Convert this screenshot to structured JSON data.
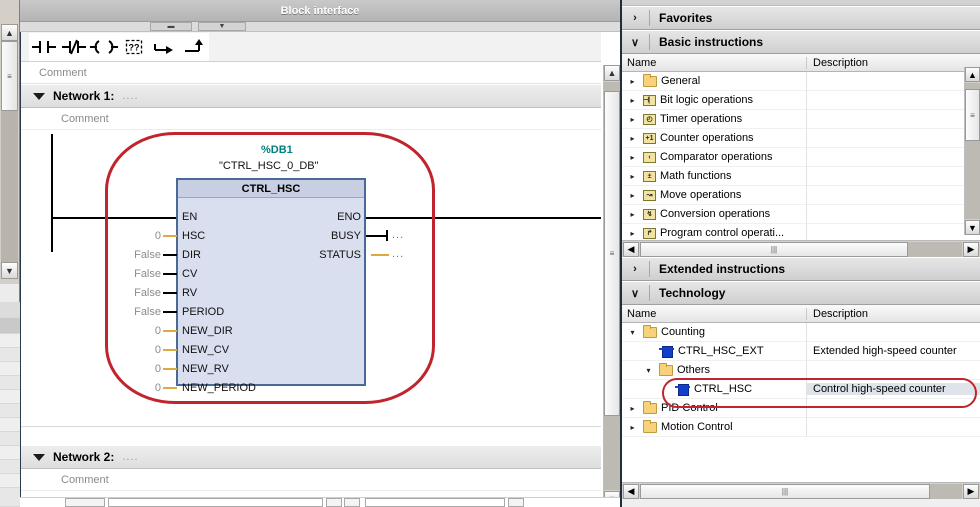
{
  "editor": {
    "block_interface_title": "Block interface",
    "toolbar": [
      {
        "name": "contact-no-icon",
        "label": "Normally open contact"
      },
      {
        "name": "contact-nc-icon",
        "label": "Normally closed contact"
      },
      {
        "name": "coil-icon",
        "label": "Output coil"
      },
      {
        "name": "empty-box-icon",
        "label": "??"
      },
      {
        "name": "open-branch-icon",
        "label": "Open branch"
      },
      {
        "name": "close-branch-icon",
        "label": "Close branch"
      }
    ],
    "top_comment": "Comment",
    "networks": [
      {
        "title": "Network 1:",
        "dots": "....",
        "comment": "Comment"
      },
      {
        "title": "Network 2:",
        "dots": "....",
        "comment": "Comment"
      }
    ],
    "block": {
      "db_number": "%DB1",
      "db_name": "\"CTRL_HSC_0_DB\"",
      "block_name": "CTRL_HSC",
      "inputs": [
        {
          "pin": "EN",
          "value": "",
          "wire": "black"
        },
        {
          "pin": "HSC",
          "value": "0",
          "wire": "yellow"
        },
        {
          "pin": "DIR",
          "value": "False",
          "wire": "black"
        },
        {
          "pin": "CV",
          "value": "False",
          "wire": "black"
        },
        {
          "pin": "RV",
          "value": "False",
          "wire": "black"
        },
        {
          "pin": "PERIOD",
          "value": "False",
          "wire": "black"
        },
        {
          "pin": "NEW_DIR",
          "value": "0",
          "wire": "yellow"
        },
        {
          "pin": "NEW_CV",
          "value": "0",
          "wire": "yellow"
        },
        {
          "pin": "NEW_RV",
          "value": "0",
          "wire": "yellow"
        },
        {
          "pin": "NEW_PERIOD",
          "value": "0",
          "wire": "yellow"
        }
      ],
      "outputs": [
        {
          "pin": "ENO",
          "value": "",
          "wire": "black"
        },
        {
          "pin": "BUSY",
          "value": "...",
          "wire": "black"
        },
        {
          "pin": "STATUS",
          "value": "...",
          "wire": "yellow"
        }
      ]
    }
  },
  "task_pane": {
    "sections": [
      {
        "name": "favorites",
        "title": "Favorites",
        "chevron": "›",
        "expanded": false
      },
      {
        "name": "basic-instructions",
        "title": "Basic instructions",
        "chevron": "∨",
        "expanded": true
      },
      {
        "name": "extended-instructions",
        "title": "Extended instructions",
        "chevron": "›",
        "expanded": false
      },
      {
        "name": "technology",
        "title": "Technology",
        "chevron": "∨",
        "expanded": true
      }
    ],
    "columns": {
      "name": "Name",
      "description": "Description"
    },
    "basic_rows": [
      {
        "label": "General",
        "desc": "",
        "icon": "folder",
        "twisty": "▸",
        "indent": 0
      },
      {
        "label": "Bit logic operations",
        "desc": "",
        "icon": "ins:⊣⎸",
        "twisty": "▸",
        "indent": 0
      },
      {
        "label": "Timer operations",
        "desc": "",
        "icon": "ins:◴",
        "twisty": "▸",
        "indent": 0
      },
      {
        "label": "Counter operations",
        "desc": "",
        "icon": "ins:+1",
        "twisty": "▸",
        "indent": 0
      },
      {
        "label": "Comparator operations",
        "desc": "",
        "icon": "ins:‹",
        "twisty": "▸",
        "indent": 0
      },
      {
        "label": "Math functions",
        "desc": "",
        "icon": "ins:±",
        "twisty": "▸",
        "indent": 0
      },
      {
        "label": "Move operations",
        "desc": "",
        "icon": "ins:↝",
        "twisty": "▸",
        "indent": 0
      },
      {
        "label": "Conversion operations",
        "desc": "",
        "icon": "ins:↯",
        "twisty": "▸",
        "indent": 0
      },
      {
        "label": "Program control operati...",
        "desc": "",
        "icon": "ins:↱",
        "twisty": "▸",
        "indent": 0
      }
    ],
    "technology_rows": [
      {
        "label": "Counting",
        "desc": "",
        "icon": "folder",
        "twisty": "▾",
        "indent": 0,
        "selected": false
      },
      {
        "label": "CTRL_HSC_EXT",
        "desc": "Extended high-speed counter",
        "icon": "fb",
        "twisty": "",
        "indent": 1,
        "selected": false
      },
      {
        "label": "Others",
        "desc": "",
        "icon": "folder",
        "twisty": "▾",
        "indent": 1,
        "selected": false
      },
      {
        "label": "CTRL_HSC",
        "desc": "Control high-speed counter",
        "icon": "fb",
        "twisty": "",
        "indent": 2,
        "selected": true
      },
      {
        "label": "PID Control",
        "desc": "",
        "icon": "folder",
        "twisty": "▸",
        "indent": 0,
        "selected": false
      },
      {
        "label": "Motion Control",
        "desc": "",
        "icon": "folder",
        "twisty": "▸",
        "indent": 0,
        "selected": false
      }
    ]
  },
  "colors": {
    "annotation_red": "#c0242c",
    "db_teal": "#00827d",
    "block_fill": "#d9dfef",
    "block_border": "#4a6a96",
    "wire_yellow": "#e0a93c"
  }
}
